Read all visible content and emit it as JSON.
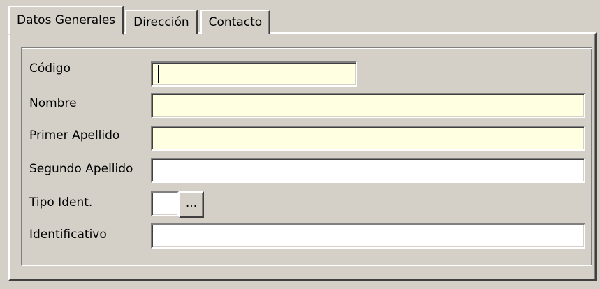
{
  "tabs": [
    {
      "label": "Datos Generales",
      "active": true
    },
    {
      "label": "Dirección",
      "active": false
    },
    {
      "label": "Contacto",
      "active": false
    }
  ],
  "form": {
    "codigo": {
      "label": "Código",
      "value": "",
      "required": true
    },
    "nombre": {
      "label": "Nombre",
      "value": "",
      "required": true
    },
    "primer_apellido": {
      "label": "Primer Apellido",
      "value": "",
      "required": true
    },
    "segundo_apellido": {
      "label": "Segundo Apellido",
      "value": "",
      "required": false
    },
    "tipo_ident": {
      "label": "Tipo Ident.",
      "value": "",
      "button_label": "..."
    },
    "identificativo": {
      "label": "Identificativo",
      "value": "",
      "required": false
    }
  },
  "colors": {
    "window_bg": "#d4d0c8",
    "required_field_bg": "#ffffe1",
    "optional_field_bg": "#ffffff"
  }
}
